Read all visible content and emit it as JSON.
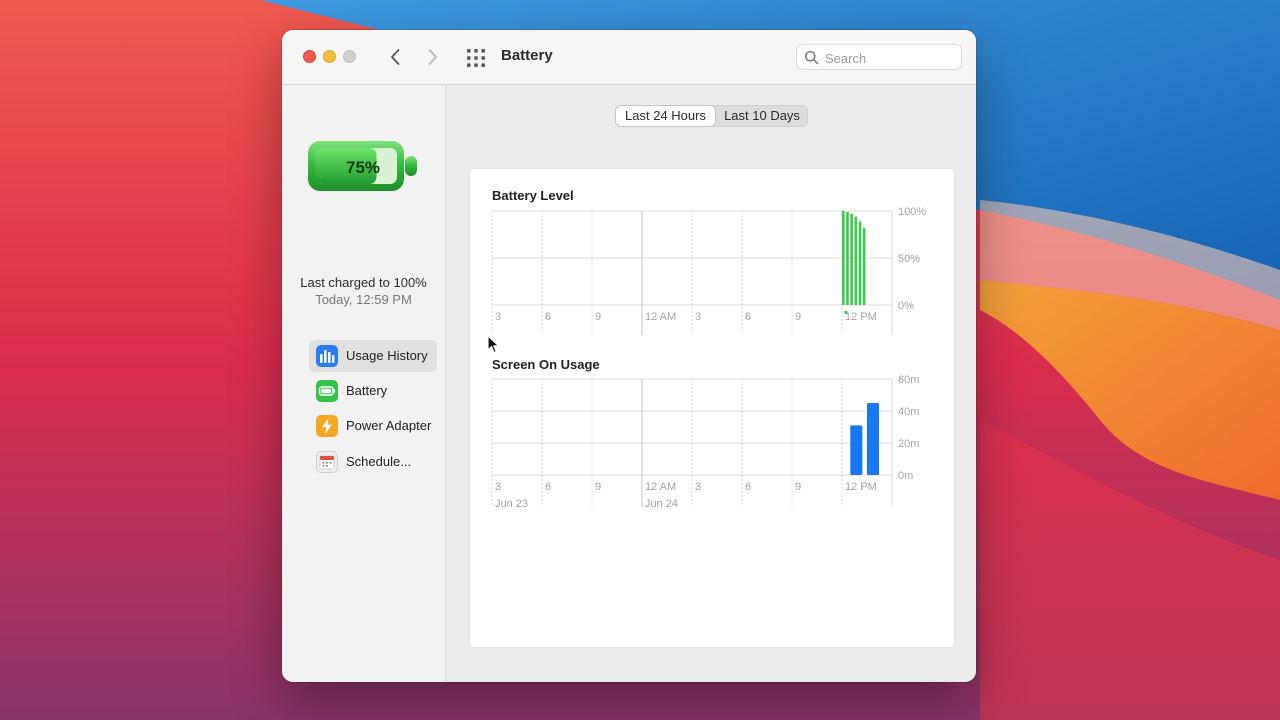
{
  "window": {
    "title": "Battery"
  },
  "search": {
    "placeholder": "Search"
  },
  "sidebar": {
    "battery_percent": "75%",
    "battery_level": 0.75,
    "last_charged": "Last charged to 100%",
    "last_charged_time": "Today, 12:59 PM",
    "items": [
      {
        "label": "Usage History",
        "icon": "bar-chart-icon",
        "color": "#2a7bf0",
        "selected": true
      },
      {
        "label": "Battery",
        "icon": "battery-icon",
        "color": "#34c24a",
        "selected": false
      },
      {
        "label": "Power Adapter",
        "icon": "lightning-icon",
        "color": "#f5a623",
        "selected": false
      },
      {
        "label": "Schedule...",
        "icon": "calendar-icon",
        "color": "#e8e8e8",
        "selected": false
      }
    ]
  },
  "segmented": {
    "options": [
      "Last 24 Hours",
      "Last 10 Days"
    ],
    "selected": 0
  },
  "help_label": "?",
  "colors": {
    "battery_green": "#3dc94c",
    "usage_blue": "#1778f2",
    "accent": "#2a7bf0"
  },
  "chart_data": [
    {
      "type": "bar",
      "title": "Battery Level",
      "x_tick_labels": [
        "3",
        "6",
        "9",
        "12 AM",
        "3",
        "6",
        "9",
        "12 PM"
      ],
      "y_tick_labels": [
        "100%",
        "50%",
        "0%"
      ],
      "ylim": [
        0,
        100
      ],
      "grid": true,
      "x_hours": [
        21.0,
        21.25,
        21.5,
        21.75,
        22.0,
        22.25
      ],
      "values": [
        100,
        99,
        97,
        94,
        89,
        82
      ],
      "charging_indicator_hour": 21.15,
      "color": "#3dc94c"
    },
    {
      "type": "bar",
      "title": "Screen On Usage",
      "x_tick_labels": [
        "3",
        "6",
        "9",
        "12 AM",
        "3",
        "6",
        "9",
        "12 PM"
      ],
      "date_labels": [
        "Jun 23",
        "Jun 24"
      ],
      "y_tick_labels": [
        "60m",
        "40m",
        "20m",
        "0m"
      ],
      "ylim": [
        0,
        60
      ],
      "grid": true,
      "x_hours": [
        21.5,
        22.5
      ],
      "values": [
        31,
        45
      ],
      "color": "#1778f2"
    }
  ]
}
